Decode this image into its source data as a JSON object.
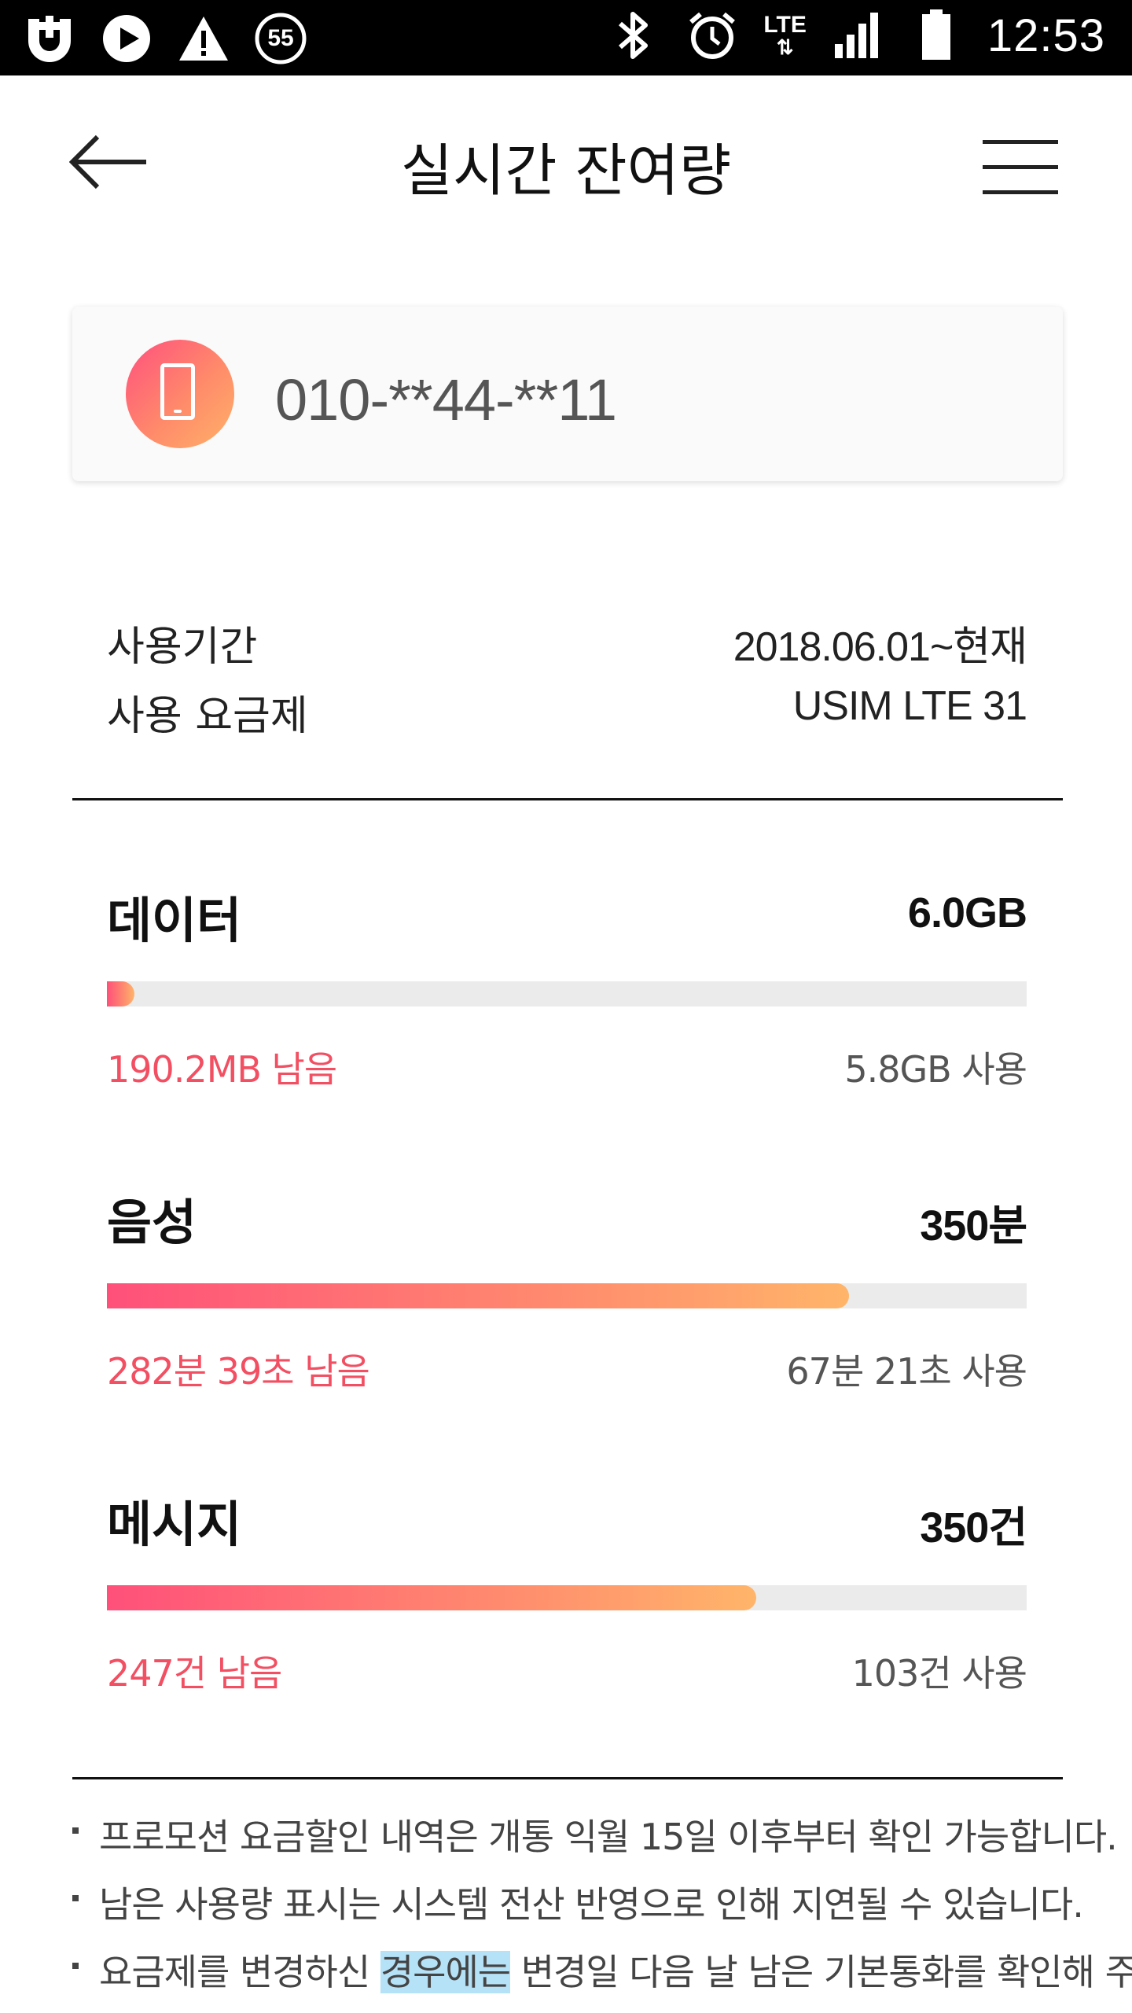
{
  "status_bar": {
    "time": "12:53",
    "notification_count": "55",
    "network": "LTE",
    "icons": [
      "uplus-icon",
      "play-icon",
      "warning-icon",
      "notification-count-icon",
      "bluetooth-icon",
      "alarm-icon",
      "lte-icon",
      "signal-icon",
      "battery-icon"
    ]
  },
  "header": {
    "title": "실시간 잔여량"
  },
  "account": {
    "phone_number": "010-**44-**11"
  },
  "info": {
    "period_label": "사용기간",
    "period_value": "2018.06.01~현재",
    "plan_label": "사용 요금제",
    "plan_value": "USIM LTE 31"
  },
  "usage": [
    {
      "name": "데이터",
      "total": "6.0GB",
      "remaining": "190.2MB 남음",
      "used": "5.8GB 사용",
      "remaining_fraction": 0.03
    },
    {
      "name": "음성",
      "total": "350분",
      "remaining": "282분 39초 남음",
      "used": "67분 21초 사용",
      "remaining_fraction": 0.807
    },
    {
      "name": "메시지",
      "total": "350건",
      "remaining": "247건 남음",
      "used": "103건 사용",
      "remaining_fraction": 0.706
    }
  ],
  "notes": {
    "n1": "프로모션 요금할인 내역은 개통 익월 15일 이후부터 확인 가능합니다.",
    "n2": "남은 사용량 표시는 시스템 전산 반영으로 인해 지연될 수 있습니다.",
    "n3_pre": "요금제를 변경하신 ",
    "n3_highlight": "경우에는",
    "n3_post": " 변경일 다음 날 남은 기본통화를 확인해 주"
  },
  "colors": {
    "accent_start": "#ff507a",
    "accent_end": "#ffb56a",
    "remaining_text": "#f24f62",
    "highlight": "#b6e2f7"
  }
}
